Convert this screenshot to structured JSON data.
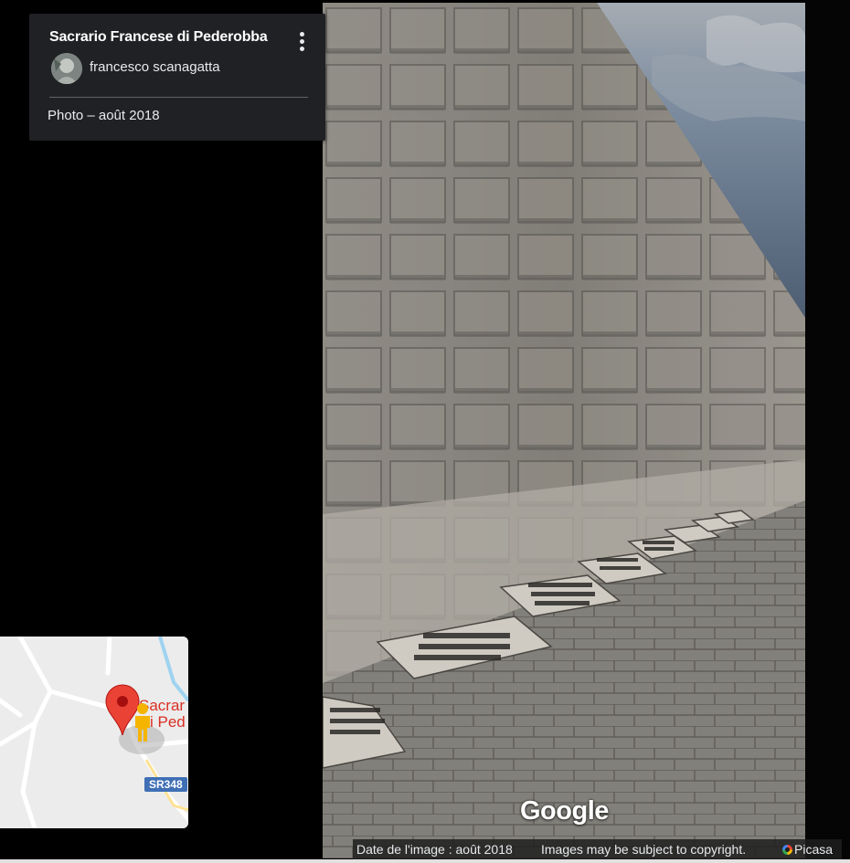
{
  "card": {
    "title": "Sacrario Francese di Pederobba",
    "author": "francesco scanagatta",
    "photo_date": "Photo – août 2018",
    "menu_icon": "more-vert-icon"
  },
  "minimap": {
    "place_label_line1": "Sacrar",
    "place_label_line2": "i Ped",
    "road_badge": "SR348",
    "marker_icon": "map-pin-icon",
    "pegman_icon": "pegman-icon"
  },
  "photo": {
    "google_logo": "Google",
    "image_date": "Date de l'image : août 2018",
    "copyright": "Images may be subject to copyright.",
    "source": "Picasa"
  },
  "colors": {
    "card_bg": "#202124",
    "pin_red": "#ea4335",
    "pegman_yellow": "#f4b400",
    "road_badge_blue": "#3f6fb5"
  }
}
